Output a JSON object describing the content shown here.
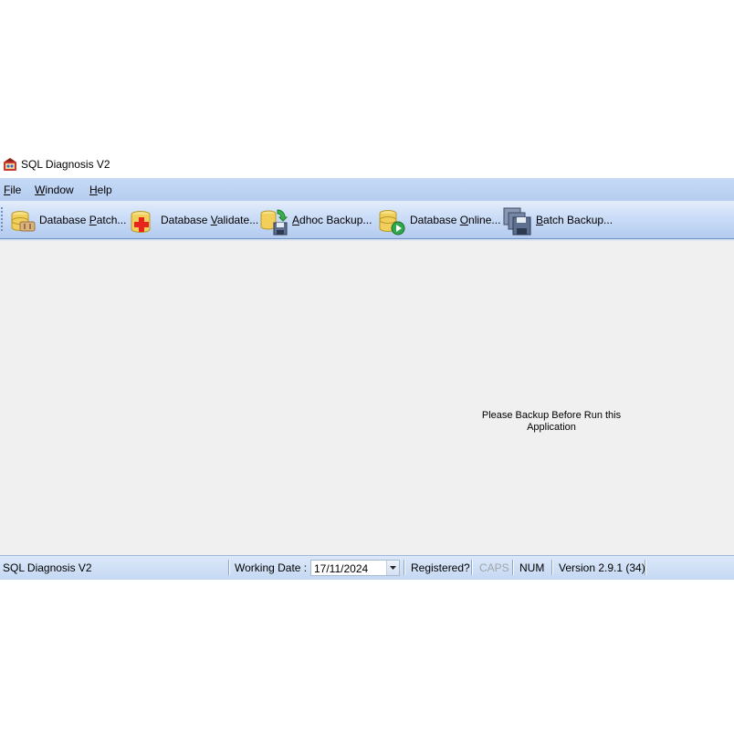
{
  "window": {
    "title": "SQL Diagnosis V2",
    "icon": "sql-diagnosis-app-icon"
  },
  "menu": {
    "items": [
      {
        "accel": "F",
        "rest": "ile"
      },
      {
        "accel": "W",
        "rest": "indow"
      },
      {
        "accel": "H",
        "rest": "elp"
      }
    ]
  },
  "toolbar": {
    "buttons": [
      {
        "pre": "Database ",
        "accel": "P",
        "post": "atch...",
        "icon": "database-patch-icon"
      },
      {
        "pre": "Database ",
        "accel": "V",
        "post": "alidate...",
        "icon": "database-validate-icon"
      },
      {
        "pre": "",
        "accel": "A",
        "post": "dhoc Backup...",
        "icon": "adhoc-backup-icon"
      },
      {
        "pre": "Database ",
        "accel": "O",
        "post": "nline...",
        "icon": "database-online-icon"
      },
      {
        "pre": "",
        "accel": "B",
        "post": "atch Backup...",
        "icon": "batch-backup-icon"
      }
    ]
  },
  "main": {
    "notice_line1": "Please Backup Before Run this",
    "notice_line2": "Application"
  },
  "statusbar": {
    "app_name": "SQL Diagnosis V2",
    "working_date_label": "Working Date :",
    "working_date_value": "17/11/2024",
    "registered": "Registered?",
    "caps": "CAPS",
    "num": "NUM",
    "version": "Version 2.9.1 (34)"
  },
  "colors": {
    "menubar": "#c5daf6",
    "toolbar_top": "#e3edfb",
    "toolbar_bottom": "#b3cbef",
    "client": "#f0f0f0",
    "status_disabled": "#a0a6ad"
  }
}
